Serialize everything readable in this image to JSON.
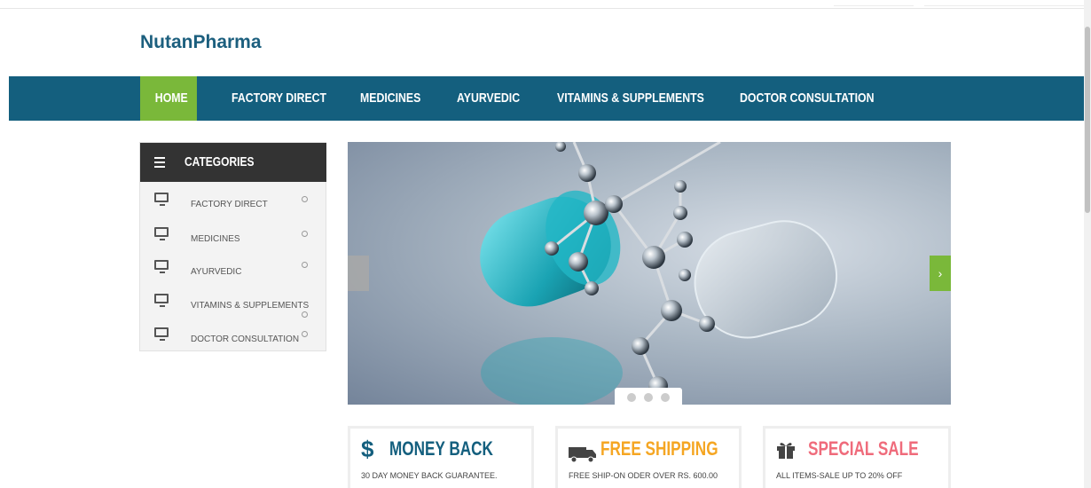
{
  "brand": {
    "name": "NutanPharma"
  },
  "nav": {
    "items": [
      "HOME",
      "FACTORY DIRECT",
      "MEDICINES",
      "AYURVEDIC",
      "VITAMINS & SUPPLEMENTS",
      "DOCTOR CONSULTATION"
    ],
    "active_color": "#7ab83a",
    "bar_color": "#145f7e"
  },
  "sidebar": {
    "title": "CATEGORIES",
    "items": [
      "FACTORY DIRECT",
      "MEDICINES",
      "AYURVEDIC",
      "VITAMINS & SUPPLEMENTS",
      "DOCTOR CONSULTATION"
    ]
  },
  "slider": {
    "next_symbol": "›",
    "dots": 3
  },
  "features": [
    {
      "icon": "dollar-icon",
      "symbol": "$",
      "title": "MONEY BACK",
      "subtitle": "30 DAY MONEY BACK GUARANTEE.",
      "color": "#145f7e"
    },
    {
      "icon": "truck-icon",
      "title": "FREE SHIPPING",
      "subtitle": "FREE SHIP-ON ODER OVER RS. 600.00",
      "color": "#f5a623"
    },
    {
      "icon": "gift-icon",
      "title": "SPECIAL SALE",
      "subtitle": "ALL ITEMS-SALE UP TO 20% OFF",
      "color": "#ef6b7b"
    }
  ]
}
